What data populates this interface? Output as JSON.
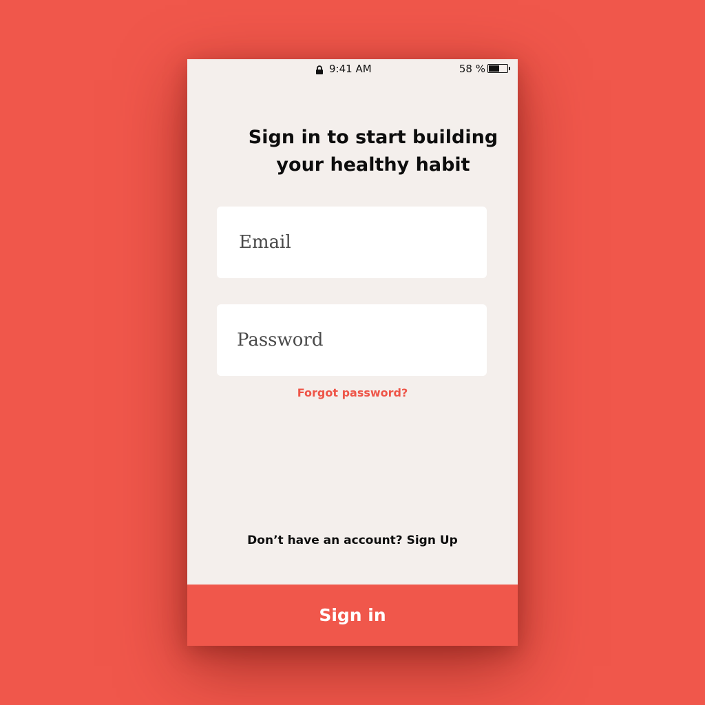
{
  "status_bar": {
    "time": "9:41 AM",
    "battery_percent_label": "58 %",
    "battery_level": 0.58,
    "icons": [
      "lock-icon",
      "battery-icon"
    ]
  },
  "colors": {
    "background": "#f0574b",
    "screen": "#f4efec",
    "field": "#ffffff",
    "accent": "#ee5548",
    "text": "#0d0d0d"
  },
  "header": {
    "title_line1": "Sign in to start building",
    "title_line2": "your healthy habit"
  },
  "form": {
    "email": {
      "value": "",
      "placeholder": "Email"
    },
    "password": {
      "value": "",
      "placeholder": "Password"
    },
    "forgot_label": "Forgot password?"
  },
  "footer": {
    "no_account_text": "Don’t have an account?",
    "signup_label": "Sign Up",
    "signin_label": "Sign in"
  }
}
